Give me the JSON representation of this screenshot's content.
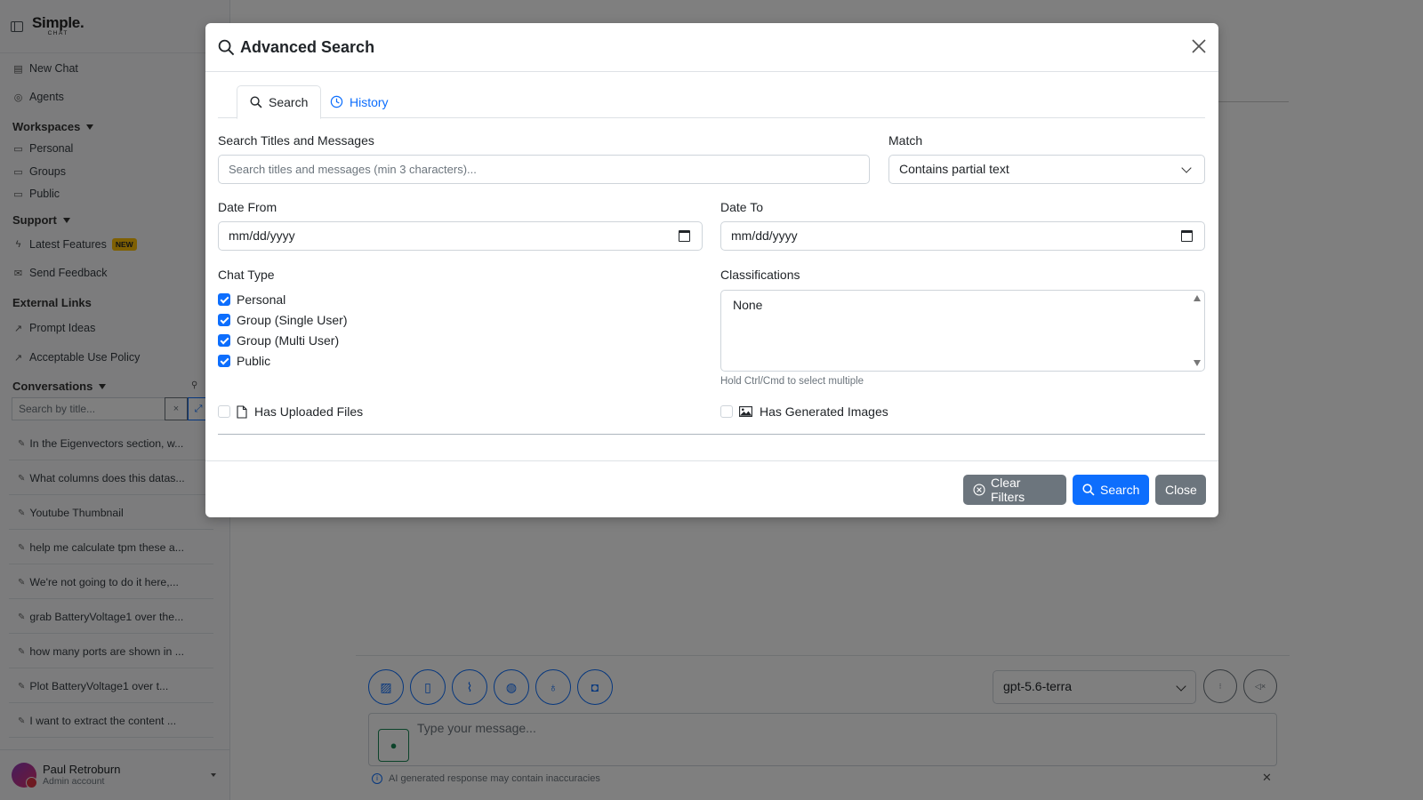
{
  "sidebar": {
    "logo_main": "Simple.",
    "logo_sub": "CHAT",
    "new_chat": "New Chat",
    "agents": "Agents",
    "workspaces_head": "Workspaces",
    "personal": "Personal",
    "groups": "Groups",
    "public": "Public",
    "support_head": "Support",
    "latest_features": "Latest Features",
    "new_badge": "NEW",
    "send_feedback": "Send Feedback",
    "external_head": "External Links",
    "prompt_ideas": "Prompt Ideas",
    "acceptable_use": "Acceptable Use Policy",
    "conversations_head": "Conversations",
    "search_placeholder": "Search by title...",
    "conversations": [
      "In the Eigenvectors section, w...",
      "What columns does this datas...",
      "Youtube Thumbnail",
      "help me calculate tpm these a...",
      "We're not going to do it here,...",
      "grab BatteryVoltage1 over the...",
      "how many ports are shown in ...",
      "Plot BatteryVoltage1 over t...",
      "I want to extract the content ..."
    ],
    "user_name": "Paul Retroburn",
    "user_role": "Admin account"
  },
  "composer": {
    "model": "gpt-5.6-terra",
    "message_placeholder": "Type your message...",
    "disclaimer": "AI generated response may contain inaccuracies"
  },
  "modal": {
    "title": "Advanced Search",
    "tabs": {
      "search": "Search",
      "history": "History"
    },
    "search_label": "Search Titles and Messages",
    "search_placeholder": "Search titles and messages (min 3 characters)...",
    "match_label": "Match",
    "match_value": "Contains partial text",
    "date_from_label": "Date From",
    "date_to_label": "Date To",
    "date_placeholder": "mm/dd/yyyy",
    "chat_type_label": "Chat Type",
    "chat_types": [
      {
        "label": "Personal",
        "checked": true
      },
      {
        "label": "Group (Single User)",
        "checked": true
      },
      {
        "label": "Group (Multi User)",
        "checked": true
      },
      {
        "label": "Public",
        "checked": true
      }
    ],
    "classifications_label": "Classifications",
    "classification_option": "None",
    "classifications_hint": "Hold Ctrl/Cmd to select multiple",
    "has_uploaded_files": "Has Uploaded Files",
    "has_generated_images": "Has Generated Images",
    "buttons": {
      "clear": "Clear Filters",
      "search": "Search",
      "close": "Close"
    }
  },
  "colors": {
    "primary": "#0d6efd",
    "secondary": "#6c757d",
    "badge": "#ffc107"
  }
}
